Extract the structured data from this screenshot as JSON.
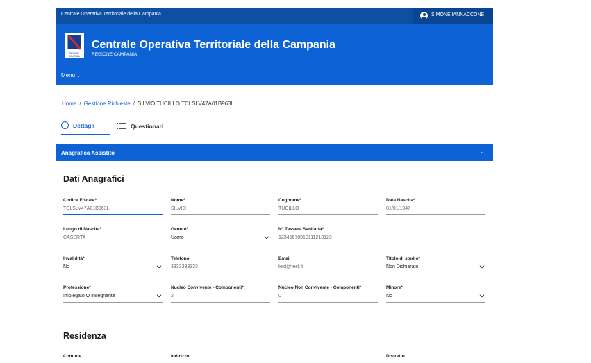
{
  "topbar": {
    "title": "Centrale Operativa Territoriale della Campania",
    "user": "SIMONE IANNACCONE"
  },
  "header": {
    "title": "Centrale Operativa Territoriale della Campania",
    "subtitle": "REGIONE CAMPANIA",
    "logo_caption": "REGIONE CAMPANIA",
    "menu_label": "Menu",
    "menu_icon": "chevron-down-icon"
  },
  "breadcrumb": [
    {
      "label": "Home",
      "link": true
    },
    {
      "label": "Gestione Richieste",
      "link": true
    },
    {
      "label": "SILVIO TUCILLO TCLSLV47A01B963L",
      "link": false
    }
  ],
  "tabs": [
    {
      "label": "Dettagli",
      "icon": "info-icon",
      "active": true
    },
    {
      "label": "Questionari",
      "icon": "list-icon",
      "active": false
    }
  ],
  "accordion": {
    "title": "Anagrafica Assistito",
    "icon": "chevron-down-icon"
  },
  "dati": {
    "title": "Dati Anagrafici",
    "codice_fiscale": {
      "label": "Codice Fiscale*",
      "value": "TCLSLV47A01B963L"
    },
    "nome": {
      "label": "Nome*",
      "value": "SILVIO"
    },
    "cognome": {
      "label": "Cognome*",
      "value": "TUCILLO"
    },
    "data_nascita": {
      "label": "Data Nascita*",
      "value": "01/01/1947"
    },
    "luogo_nascita": {
      "label": "Luogo di Nascita*",
      "value": "CASERTA"
    },
    "genere": {
      "label": "Genere*",
      "value": "Uomo"
    },
    "tessera": {
      "label": "N° Tessera Sanitaria*",
      "value": "12345678910111213123"
    },
    "invalidita": {
      "label": "Invalidità*",
      "value": "No"
    },
    "telefono": {
      "label": "Telefono",
      "value": "3333333333"
    },
    "email": {
      "label": "Email",
      "value": "test@test.it"
    },
    "titolo_studio": {
      "label": "Titolo di studio*",
      "value": "Non Dichiarato"
    },
    "professione": {
      "label": "Professione*",
      "value": "Impiegato O Insegnante"
    },
    "nucleo_conv": {
      "label": "Nucleo Convivente - Componenti*",
      "value": "2"
    },
    "nucleo_non_conv": {
      "label": "Nucleo Non Convivente - Componenti*",
      "value": "0"
    },
    "minore": {
      "label": "Minore*",
      "value": "No"
    }
  },
  "residenza": {
    "title": "Residenza",
    "comune_label": "Comune",
    "indirizzo_label": "Indirizzo",
    "distretto_label": "Distretto"
  },
  "colors": {
    "primary": "#0d63d6",
    "topbar": "#0c4fa3",
    "user_area": "#0a4592"
  }
}
